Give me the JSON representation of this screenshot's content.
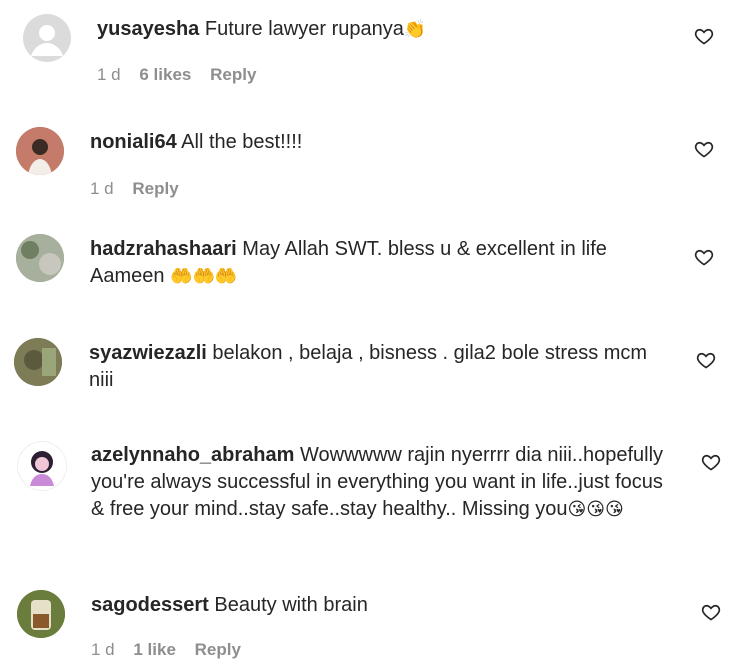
{
  "comments": [
    {
      "username": "yusayesha",
      "text": "Future lawyer rupanya",
      "emoji": "👏",
      "time": "1 d",
      "likes": "6 likes",
      "reply": "Reply"
    },
    {
      "username": "noniali64",
      "text": "All the best!!!!",
      "time": "1 d",
      "reply": "Reply"
    },
    {
      "username": "hadzrahashaari",
      "text": "May Allah SWT. bless u & excellent in life Aameen",
      "emoji": "🤲🤲🤲"
    },
    {
      "username": "syazwiezazli",
      "text": "belakon , belaja , bisness . gila2 bole stress mcm niii"
    },
    {
      "username": "azelynnaho_abraham",
      "text": "Wowwwww rajin nyerrrr dia niii..hopefully you're always successful in everything you want in life..just focus & free your mind..stay safe..stay healthy.. Missing you",
      "emoji": "😘😘😘"
    },
    {
      "username": "sagodessert",
      "text": "Beauty with brain",
      "time": "1 d",
      "likes": "1 like",
      "reply": "Reply"
    }
  ],
  "colors": {
    "text": "#262626",
    "muted": "#8e8e8e"
  },
  "icons": {
    "like": "heart-outline-icon"
  }
}
